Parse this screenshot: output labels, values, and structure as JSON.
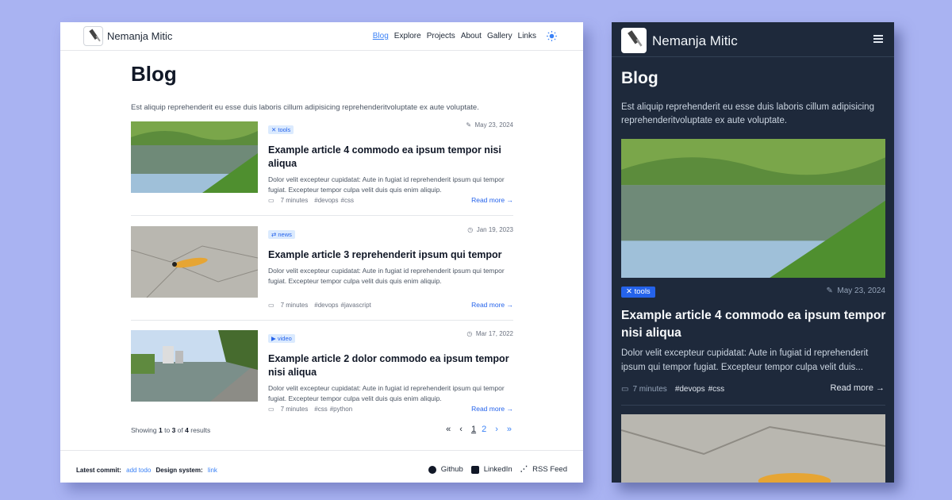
{
  "brand": "Nemanja Mitic",
  "nav": [
    "Blog",
    "Explore",
    "Projects",
    "About",
    "Gallery",
    "Links"
  ],
  "page": {
    "title": "Blog",
    "intro": "Est aliquip reprehenderit eu esse duis laboris cillum adipisicing reprehenderitvoluptate ex aute voluptate."
  },
  "posts": [
    {
      "tag": "tools",
      "date": "May 23, 2024",
      "title": "Example article 4 commodo ea ipsum tempor nisi aliqua",
      "excerpt": "Dolor velit excepteur cupidatat: Aute in fugiat id reprehenderit ipsum qui tempor fugiat. Excepteur tempor culpa velit duis quis enim aliquip.",
      "read_time": "7 minutes",
      "tags": [
        "#devops",
        "#css"
      ],
      "more": "Read more →"
    },
    {
      "tag": "news",
      "date": "Jan 19, 2023",
      "title": "Example article 3 reprehenderit ipsum qui tempor",
      "excerpt": "Dolor velit excepteur cupidatat: Aute in fugiat id reprehenderit ipsum qui tempor fugiat. Excepteur tempor culpa velit duis quis enim aliquip.",
      "read_time": "7 minutes",
      "tags": [
        "#devops",
        "#javascript"
      ],
      "more": "Read more →"
    },
    {
      "tag": "video",
      "date": "Mar 17, 2022",
      "title": "Example article 2 dolor commodo ea ipsum tempor nisi aliqua",
      "excerpt": "Dolor velit excepteur cupidatat: Aute in fugiat id reprehenderit ipsum qui tempor fugiat. Excepteur tempor culpa velit duis quis enim aliquip.",
      "read_time": "7 minutes",
      "tags": [
        "#css",
        "#python"
      ],
      "more": "Read more →"
    }
  ],
  "pagination": {
    "showing_prefix": "Showing",
    "from": "1",
    "to_word": "to",
    "to": "3",
    "of_word": "of",
    "total": "4",
    "suffix": "results",
    "first": "«",
    "prev": "‹",
    "pages": [
      "1",
      "2"
    ],
    "next": "›",
    "last": "»"
  },
  "footer": {
    "commit_label": "Latest commit:",
    "commit_link": "add todo",
    "design_label": "Design system:",
    "design_link": "link",
    "links": [
      "Github",
      "LinkedIn",
      "RSS Feed"
    ]
  },
  "mobile": {
    "excerpt": "Dolor velit excepteur cupidatat: Aute in fugiat id reprehenderit ipsum qui tempor fugiat. Excepteur tempor culpa velit duis..."
  },
  "icons": {
    "theme": "sun-icon",
    "menu": "hamburger-icon",
    "tools": "wrench-icon",
    "news": "arrows-icon",
    "video": "video-icon",
    "pencil": "pencil-icon",
    "clock": "clock-icon",
    "book": "book-icon",
    "github": "github-icon",
    "linkedin": "linkedin-icon",
    "rss": "rss-icon"
  },
  "colors": {
    "accent": "#3b82f6",
    "page_bg": "#a9b3f2",
    "dark_bg": "#1e293b",
    "tag_bg": "#dbeafe"
  }
}
